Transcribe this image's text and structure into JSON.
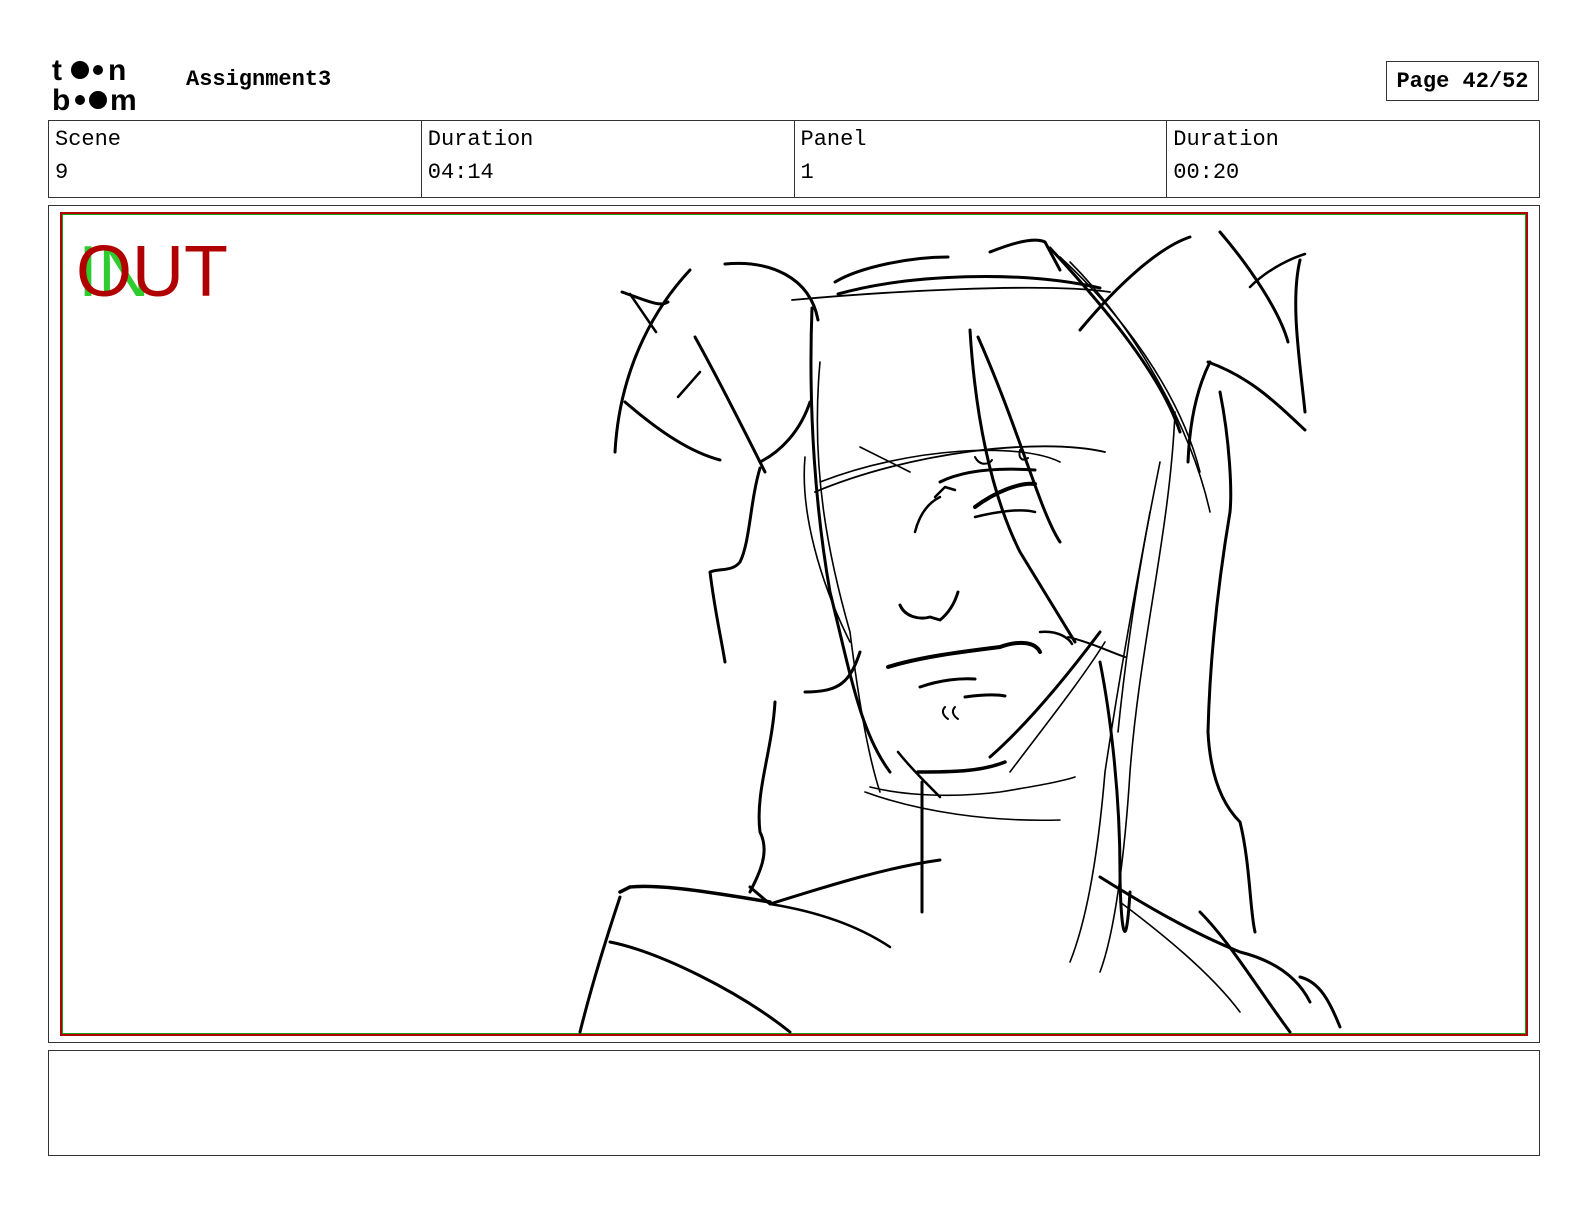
{
  "header": {
    "logo_text_top": "t●●n",
    "logo_text_bottom": "b●●m",
    "project_title": "Assignment3",
    "page_indicator": "Page 42/52"
  },
  "info": [
    {
      "label": "Scene",
      "value": "9"
    },
    {
      "label": "Duration",
      "value": "04:14"
    },
    {
      "label": "Panel",
      "value": "1"
    },
    {
      "label": "Duration",
      "value": "00:20"
    }
  ],
  "panel": {
    "in_marker": "IN",
    "out_marker": "OUT",
    "in_color": "#2ecc2e",
    "out_color": "#b00000",
    "content": "sketch"
  },
  "notes": {
    "text": ""
  }
}
